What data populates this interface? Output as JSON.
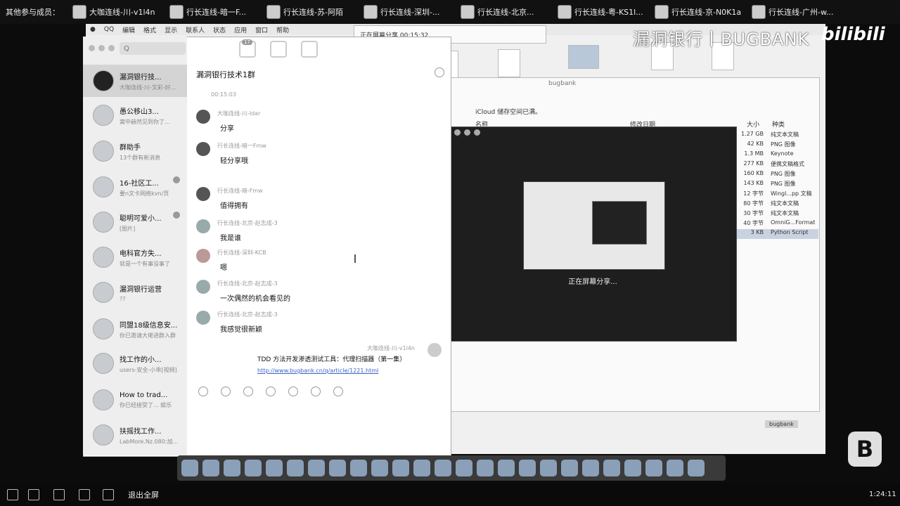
{
  "topbar": {
    "label": "其他参与成员：",
    "participants": [
      "大咖连线-川-v1l4n",
      "行长连线-暗一F...",
      "行长连线-苏-阿陌",
      "行长连线-深圳-...",
      "行长连线-北京...",
      "行长连线-粤-KS1l...",
      "行长连线-京-N0K1a",
      "行长连线-广州-w..."
    ]
  },
  "menubar": [
    "QQ",
    "编辑",
    "格式",
    "显示",
    "联系人",
    "状态",
    "应用",
    "窗口",
    "帮助"
  ],
  "share": {
    "text": "正在屏幕分享 00:15:32"
  },
  "watermark": {
    "text": "漏洞银行丨BUGBANK",
    "bili": "bilibili"
  },
  "chat": {
    "search_placeholder": "Q",
    "unread_count": "17",
    "title": "漏洞银行技术1群",
    "conversations": [
      {
        "name": "漏洞银行技...",
        "preview": "大咖连线-川-文彩-好..."
      },
      {
        "name": "愚公移山3...",
        "preview": "窝中赫然见到你了..."
      },
      {
        "name": "群助手",
        "preview": "13个群有新消息"
      },
      {
        "name": "16-社区工...",
        "preview": "要n文卡网络kvn/页"
      },
      {
        "name": "聪明可爱小...",
        "preview": "[图片]"
      },
      {
        "name": "电科官方失...",
        "preview": "就是一个有事没事了"
      },
      {
        "name": "漏洞银行运营",
        "preview": "??"
      },
      {
        "name": "同盟18级信息安...",
        "preview": "你已邀请大佬进群入群"
      },
      {
        "name": "找工作的小...",
        "preview": "users-安全-小乖[视频]"
      },
      {
        "name": "How to trad...",
        "preview": "你已经接受了... 娱乐"
      },
      {
        "name": "扶摇找工作...",
        "preview": "LabMore.Nz.080:加..."
      }
    ],
    "messages": [
      {
        "name": "大咖连线-川-Idar",
        "text": "分享"
      },
      {
        "name": "行长连线-暗一Fmw",
        "text": "轻分享哦"
      },
      {
        "name": "行长连线-暗-Fmw",
        "text": "值得拥有"
      },
      {
        "name": "行长连线-北京-赵志成-3",
        "text": "我是谁"
      },
      {
        "name": "行长连线-深圳-KCB",
        "text": "嗯"
      },
      {
        "name": "行长连线-北京-赵志成-3",
        "text": "一次偶然的机会看见的"
      },
      {
        "name": "行长连线-北京-赵志成-3",
        "text": "我感觉很新颖"
      }
    ],
    "timestamp": "00:15:03",
    "my_name": "大咖连线-川-v1l4n",
    "my_message": "TDD 方法开发渗透测试工具：代理扫描器（第一集）",
    "my_link": "http://www.bugbank.cn/q/article/1221.html"
  },
  "finder": {
    "title": "bugbank",
    "path": "iCloud 储存空间已满。",
    "columns": {
      "name": "名称",
      "date": "修改日期",
      "size": "大小",
      "kind": "种类"
    },
    "rows": [
      {
        "size": "1.27 GB",
        "kind": "纯文本文稿"
      },
      {
        "size": "42 KB",
        "kind": "PNG 图像"
      },
      {
        "size": "1.3 MB",
        "kind": "Keynote"
      },
      {
        "size": "277 KB",
        "kind": "便携文稿格式"
      },
      {
        "size": "160 KB",
        "kind": "PNG 图像"
      },
      {
        "size": "143 KB",
        "kind": "PNG 图像"
      },
      {
        "size": "12 字节",
        "kind": "Wingl...pp 文稿"
      },
      {
        "size": "80 字节",
        "kind": "纯文本文稿"
      },
      {
        "size": "30 字节",
        "kind": "纯文本文稿"
      },
      {
        "size": "40 字节",
        "kind": "OmniG...Format"
      },
      {
        "size": "3 KB",
        "kind": "Python Script"
      }
    ]
  },
  "overlay": {
    "text": "正在屏幕分享..."
  },
  "dock": {
    "tag": "bugbank"
  },
  "botbar": {
    "exit": "退出全屏",
    "time": "1:24:11"
  },
  "colors": {
    "accent_link": "#3a64c8",
    "overlay_bg": "#1e1e1e"
  }
}
